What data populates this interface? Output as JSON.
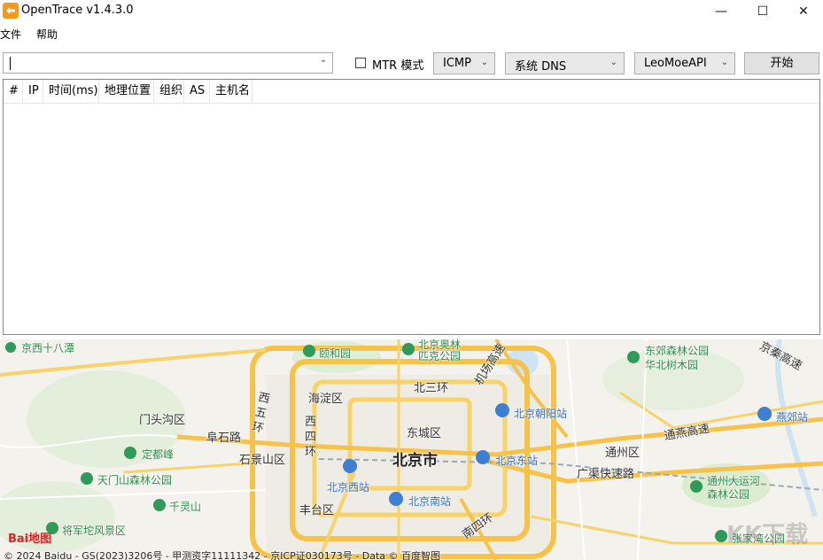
{
  "window": {
    "title": "OpenTrace v1.4.3.0",
    "minimize": "—",
    "maximize": "☐",
    "close": "✕"
  },
  "menu": {
    "items": [
      "文件",
      "帮助"
    ]
  },
  "toolbar": {
    "host_value": "",
    "mtr_label": "MTR 模式",
    "mtr_checked": false,
    "protocol": "ICMP",
    "dns": "系统 DNS",
    "api": "LeoMoeAPI",
    "start_label": "开始"
  },
  "table": {
    "columns": [
      "#",
      "IP",
      "时间(ms)",
      "地理位置",
      "组织",
      "AS",
      "主机名"
    ],
    "rows": []
  },
  "map": {
    "labels": {
      "jingxi": "京西十八潭",
      "yiheyuan": "颐和园",
      "beijing_olympic": "北京奥林匹克公园",
      "dongjiao_forest": "东郊森林公园",
      "huabei_forest": "华北树木园",
      "jingqin": "京秦高速",
      "haidian": "海淀区",
      "beisanhuan": "北三环",
      "jichang": "机场高速",
      "mentougou": "门头沟区",
      "chaoyang_station": "北京朝阳站",
      "yanjiao": "燕郊站",
      "xiwuhuan": "西五环",
      "fushi": "阜石路",
      "xisihuan": "西四环",
      "dongcheng": "东城区",
      "jingping": "通燕高速",
      "dingdu": "定都峰",
      "shijingshan": "石景山区",
      "beijing_city": "北京市",
      "beijing_east": "北京东站",
      "tongzhou": "通州区",
      "tianmen": "天门山森林公园",
      "beijing_west": "北京西站",
      "guangqu": "广渠快速路",
      "canal": "通州大运河森林公园",
      "qianling": "千灵山",
      "fengtai": "丰台区",
      "beijing_south": "北京南站",
      "nansihuan": "南四环",
      "jiangjun": "将军坨风景区",
      "zhangjiawan": "张家湾公园"
    },
    "logo": "Bai地图",
    "copyright": "© 2024 Baidu - GS(2023)3206号 - 甲测资字11111342 - 京ICP证030173号 - Data © 百度智图",
    "watermark": "KK下载"
  }
}
